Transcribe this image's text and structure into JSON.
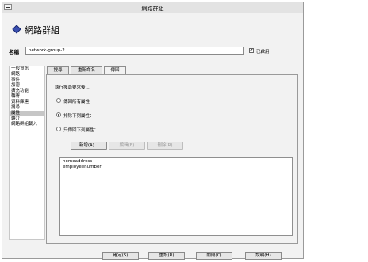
{
  "window": {
    "title": "網路群組"
  },
  "header": {
    "title": "網路群組",
    "icon": "diamond-icon"
  },
  "name_field": {
    "label": "名稱",
    "value": "network-group-2"
  },
  "enabled": {
    "label": "已啟用",
    "checked": true
  },
  "sidebar": {
    "items": [
      {
        "label": "一般資訊",
        "selected": false
      },
      {
        "label": "網路",
        "selected": false
      },
      {
        "label": "事件",
        "selected": false
      },
      {
        "label": "加密",
        "selected": false
      },
      {
        "label": "擴充功能",
        "selected": false
      },
      {
        "label": "轉寄",
        "selected": false
      },
      {
        "label": "資料庫連",
        "selected": false
      },
      {
        "label": "搜尋",
        "selected": false
      },
      {
        "label": "屬性",
        "selected": true
      },
      {
        "label": "轉介",
        "selected": false
      },
      {
        "label": "網路群組載入",
        "selected": false
      }
    ]
  },
  "tabs": [
    {
      "label": "搜尋",
      "active": false
    },
    {
      "label": "重新命名",
      "active": false
    },
    {
      "label": "傳回",
      "active": true
    }
  ],
  "panel": {
    "prompt": "執行搜尋要求後...",
    "options": [
      {
        "label": "傳回所有屬性",
        "selected": false
      },
      {
        "label": "排除下列屬性：",
        "selected": true
      },
      {
        "label": "只傳回下列屬性：",
        "selected": false
      }
    ],
    "buttons": {
      "new": "新增(A)...",
      "edit": "編輯(E)",
      "delete": "刪除(R)"
    },
    "attributes": [
      "homeaddress",
      "employeenumber"
    ]
  },
  "footer": {
    "ok": "確定(S)",
    "reset": "重設(R)",
    "close": "關閉(C)",
    "help": "說明(H)"
  }
}
